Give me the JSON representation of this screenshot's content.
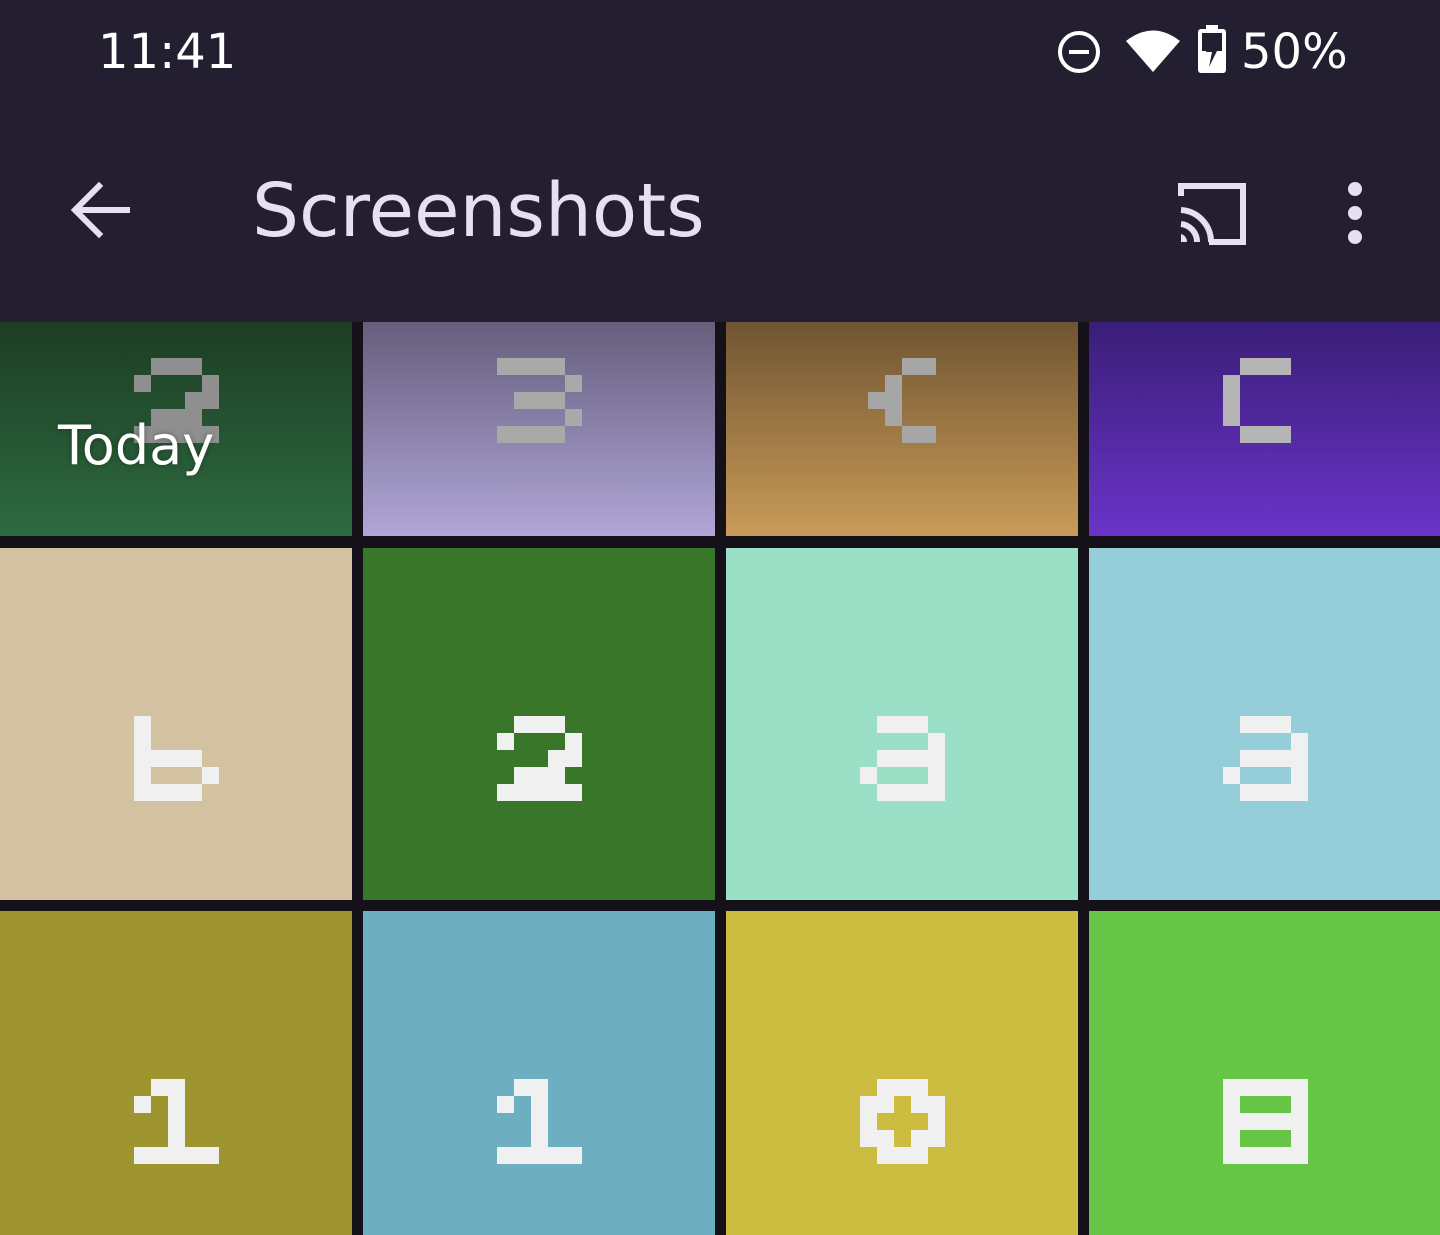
{
  "status_bar": {
    "time": "11:41",
    "battery_percent": "50%",
    "icons": [
      "do-not-disturb-icon",
      "wifi-icon",
      "battery-charging-icon"
    ]
  },
  "app_bar": {
    "title": "Screenshots",
    "back_icon": "arrow-back-icon",
    "cast_icon": "cast-icon",
    "overflow_icon": "more-vert-icon"
  },
  "section": {
    "label": "Today"
  },
  "tiles": [
    {
      "glyph": "2",
      "color_top": "#1c3d24",
      "color_bottom": "#2e6b41",
      "glyph_color": "#8f8f8f"
    },
    {
      "glyph": "3",
      "color_top": "#655e7c",
      "color_bottom": "#b0a6d8",
      "glyph_color": "#a9a9a9"
    },
    {
      "glyph": "{",
      "color_top": "#705532",
      "color_bottom": "#c99b58",
      "glyph_color": "#a6a6a6"
    },
    {
      "glyph": "c",
      "color_top": "#3a1e78",
      "color_bottom": "#6a34c8",
      "glyph_color": "#b5b5b5"
    },
    {
      "glyph": "b",
      "color": "#d2c2a2",
      "glyph_color": "#f0f0f0"
    },
    {
      "glyph": "2",
      "color": "#3a7629",
      "glyph_color": "#f0f0f0"
    },
    {
      "glyph": "a",
      "color": "#9bdfc6",
      "glyph_color": "#f0f0f0"
    },
    {
      "glyph": "a",
      "color": "#95ced8",
      "glyph_color": "#f0f0f0"
    },
    {
      "glyph": "1",
      "color": "#9e9531",
      "glyph_color": "#f0f0f0"
    },
    {
      "glyph": "1",
      "color": "#6daec0",
      "glyph_color": "#f0f0f0"
    },
    {
      "glyph": "0",
      "color": "#ccbd41",
      "glyph_color": "#f0f0f0"
    },
    {
      "glyph": "8",
      "color": "#66c446",
      "glyph_color": "#f0f0f0"
    }
  ]
}
